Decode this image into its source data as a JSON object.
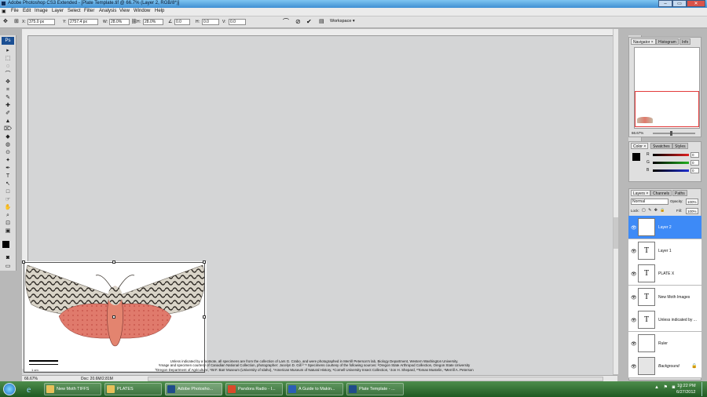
{
  "window": {
    "title": "Adobe Photoshop CS3 Extended - [Plate Template.tif @ 66.7% (Layer 2, RGB/8*)]",
    "controls": [
      "–",
      "▭",
      "✕"
    ]
  },
  "menu": [
    "File",
    "Edit",
    "Image",
    "Layer",
    "Select",
    "Filter",
    "Analysis",
    "View",
    "Window",
    "Help"
  ],
  "options": {
    "x_label": "X:",
    "x_value": "375.0 px",
    "y_label": "Y:",
    "y_value": "2757.4 px",
    "w_label": "W:",
    "w_value": "28.0%",
    "h_label": "H:",
    "h_value": "28.0%",
    "angle_value": "0.0",
    "hskew_label": "H:",
    "hskew_value": "0.0",
    "vskew_label": "V:",
    "vskew_value": "0.0",
    "workspace_label": "Workspace ▾"
  },
  "tools": [
    "▸",
    "⬚",
    "◌",
    "⌒",
    "✥",
    "⌗",
    "✎",
    "✚",
    "✐",
    "▲",
    "⌦",
    "◆",
    "◍",
    "⊙",
    "✦",
    "✒",
    "T",
    "↖",
    "□",
    "☞",
    "✋",
    "⌕",
    "⊡",
    "▣"
  ],
  "status": {
    "zoom": "66.67%",
    "doc": "Doc: 20.6M/2.81M"
  },
  "credits": [
    "Unless indicated by a footnote, all specimens are from the collection of Lars G. Crabo, and were photographed in Merrill Peterson's lab, Biology Department, Western Washington University.",
    "¹Image and specimen courtesy of Canadian National Collection, photographer: Jocelyn D. Gill  ²⁻⁸ Specimens courtesy of the following sources: ²Oregon State Arthropod Collection, Oregon State University",
    "³Oregon Department of Agriculture, ⁴W.F. Barr Museum (University of Idaho), ⁵American Museum of Natural History, ⁶Cornell University Insect Collection, ⁷Jon H. Shepard, ⁸Tomas Mustelin, ⁹Merrill A. Peterson"
  ],
  "scalebar_label": "1 cm",
  "strip_icons": [
    "⌂",
    "✎",
    "▤",
    "✂",
    "⚙",
    "♣",
    "⊞",
    "↺",
    "¶",
    "⚑"
  ],
  "navigator": {
    "tabs": [
      "Navigator ×",
      "Histogram",
      "Info"
    ],
    "zoom": "66.67%"
  },
  "color_panel": {
    "tabs": [
      "Color ×",
      "Swatches",
      "Styles"
    ],
    "channels": [
      {
        "label": "R",
        "value": "0",
        "color": "#e02020"
      },
      {
        "label": "G",
        "value": "0",
        "color": "#20b020"
      },
      {
        "label": "B",
        "value": "0",
        "color": "#2030d0"
      }
    ]
  },
  "layers_panel": {
    "tabs": [
      "Layers ×",
      "Channels",
      "Paths"
    ],
    "blend_mode": "Normal",
    "opacity_label": "Opacity:",
    "opacity_value": "100%",
    "lock_label": "Lock:",
    "fill_label": "Fill:",
    "fill_value": "100%",
    "layers": [
      {
        "name": "Layer 2",
        "kind": "pixel",
        "thumb": ""
      },
      {
        "name": "Layer 1",
        "kind": "text",
        "thumb": "T"
      },
      {
        "name": "PLATE X",
        "kind": "text",
        "thumb": "T"
      },
      {
        "name": "New Moth Images",
        "kind": "text",
        "thumb": "T"
      },
      {
        "name": "Unless indicated by ...",
        "kind": "text",
        "thumb": "T"
      },
      {
        "name": "Ruler",
        "kind": "pixel",
        "thumb": ""
      },
      {
        "name": "Background",
        "kind": "background",
        "thumb": ""
      }
    ],
    "bottom_icons": [
      "⊖",
      "fx",
      "◑",
      "▣",
      "▢",
      "⊞",
      "🗑"
    ]
  },
  "taskbar": {
    "items": [
      {
        "label": "New Moth TIFFS",
        "icon_color": "#e7c15a"
      },
      {
        "label": "PLATES",
        "icon_color": "#e7c15a"
      },
      {
        "label": "Adobe Photosho...",
        "icon_color": "#1f4c8a"
      },
      {
        "label": "Pandora Radio - I...",
        "icon_color": "#d94a2a"
      },
      {
        "label": "A Guide to Makin...",
        "icon_color": "#2b5fb5"
      },
      {
        "label": "Plate Template - ...",
        "icon_color": "#1f4c8a"
      }
    ],
    "time": "10:22 PM",
    "date": "6/27/2012"
  },
  "colors": {
    "selected_layer": "#3d8af7",
    "taskbar": "#2f6f33"
  }
}
